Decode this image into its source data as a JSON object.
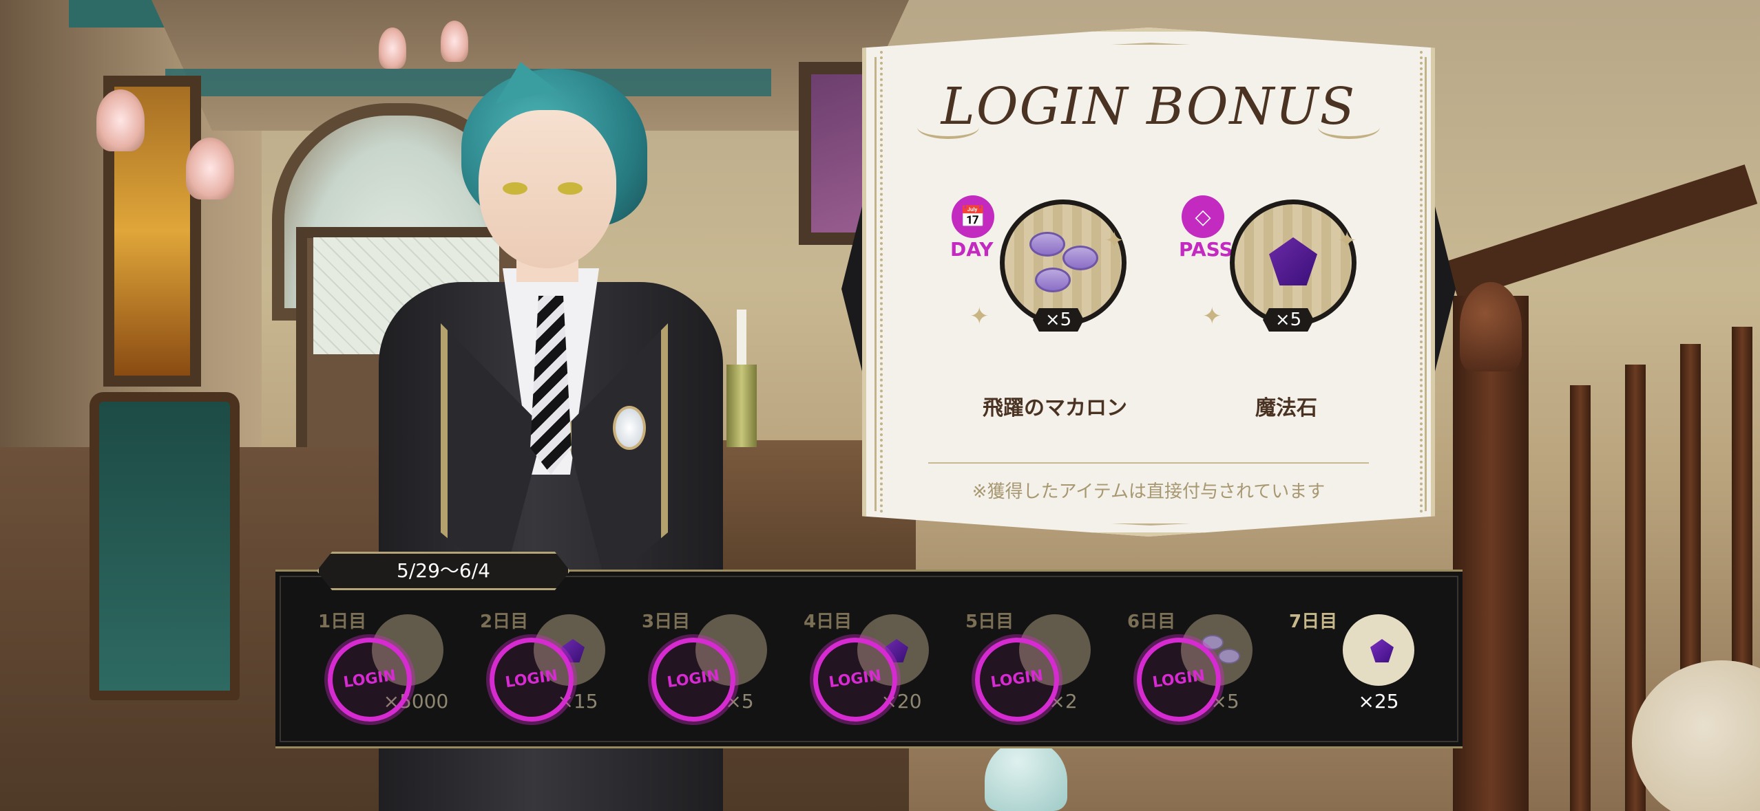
{
  "panel": {
    "title": "LOGIN BONUS",
    "rewards": [
      {
        "type_label": "DAY",
        "type_icon": "calendar-icon",
        "item": "飛躍のマカロン",
        "count": "×5"
      },
      {
        "type_label": "PASS",
        "type_icon": "diamond-icon",
        "item": "魔法石",
        "count": "×5"
      }
    ],
    "note": "※獲得したアイテムは直接付与されています"
  },
  "period": "5/29〜6/4",
  "days": [
    {
      "label": "1日目",
      "qty": "×5000",
      "stamped": true
    },
    {
      "label": "2日目",
      "qty": "×15",
      "stamped": true
    },
    {
      "label": "3日目",
      "qty": "×5",
      "stamped": true
    },
    {
      "label": "4日目",
      "qty": "×20",
      "stamped": true
    },
    {
      "label": "5日目",
      "qty": "×2",
      "stamped": true
    },
    {
      "label": "6日目",
      "qty": "×5",
      "stamped": true
    },
    {
      "label": "7日目",
      "qty": "×25",
      "stamped": false
    }
  ],
  "stamp_text": "LOGIN",
  "colors": {
    "accent": "#c22ac0",
    "stamp": "#d62bd1",
    "gold": "#b5a478"
  }
}
